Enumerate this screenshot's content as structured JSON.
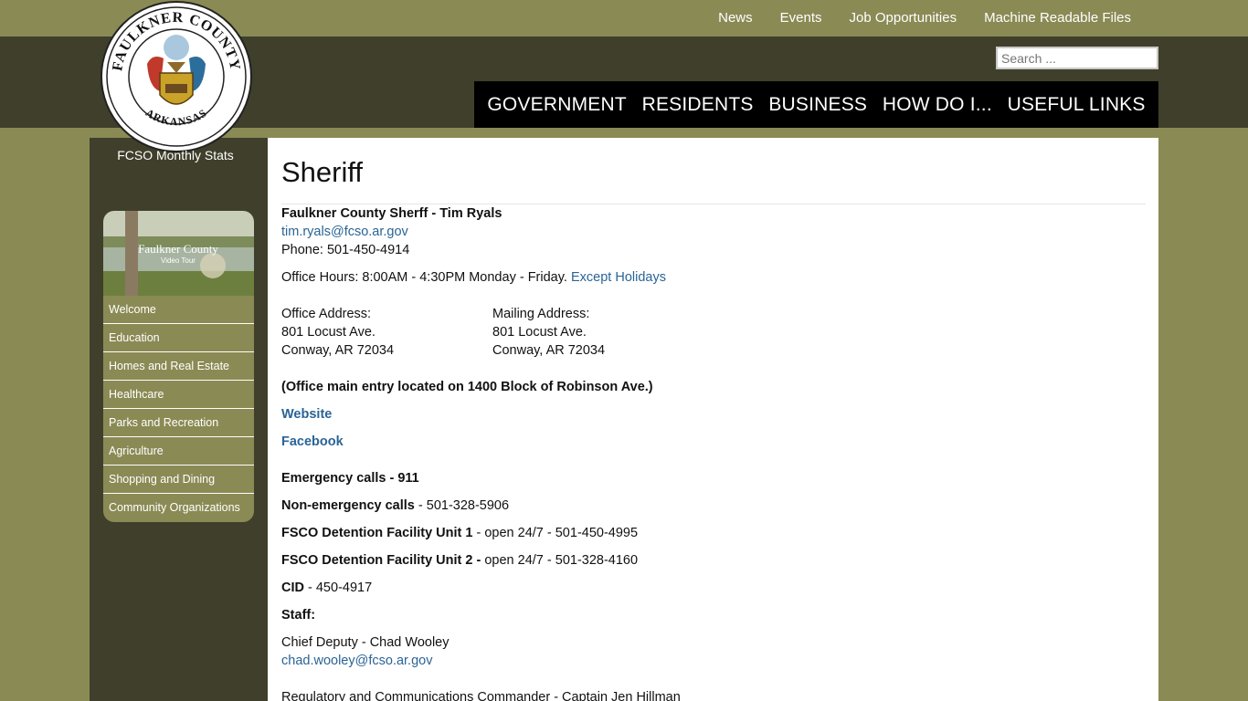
{
  "utility_nav": [
    "News",
    "Events",
    "Job Opportunities",
    "Machine Readable Files"
  ],
  "search": {
    "placeholder": "Search ..."
  },
  "main_nav": [
    "GOVERNMENT",
    "RESIDENTS",
    "BUSINESS",
    "HOW DO I...",
    "USEFUL LINKS"
  ],
  "seal": {
    "top_text": "FAULKNER COUNTY",
    "bottom_text": "ARKANSAS"
  },
  "sidebar": {
    "stats_label": "FCSO Monthly Stats",
    "video": {
      "title": "Faulkner County",
      "subtitle": "Video Tour"
    },
    "menu": [
      "Welcome",
      "Education",
      "Homes and Real Estate",
      "Healthcare",
      "Parks and Recreation",
      "Agriculture",
      "Shopping and Dining",
      "Community Organizations"
    ]
  },
  "page": {
    "title": "Sheriff",
    "sheriff_heading": "Faulkner County Sherff - Tim Ryals",
    "sheriff_email": "tim.ryals@fcso.ar.gov",
    "phone": "Phone: 501-450-4914",
    "hours_prefix": "Office Hours:  8:00AM - 4:30PM Monday - Friday.",
    "hours_link": "Except Holidays",
    "office_address": {
      "label": "Office Address:",
      "line1": "801 Locust Ave.",
      "line2": "Conway, AR 72034"
    },
    "mailing_address": {
      "label": "Mailing Address:",
      "line1": "801 Locust Ave.",
      "line2": "Conway, AR 72034"
    },
    "entry_note": "(Office main entry located on 1400 Block of Robinson Ave.)",
    "website_link": "Website",
    "facebook_link": "Facebook",
    "emergency": "Emergency calls - 911",
    "non_emergency": {
      "label": "Non-emergency calls",
      "value": " - 501-328-5906"
    },
    "unit1": {
      "label": "FSCO Detention Facility Unit 1",
      "value": " - open 24/7 - 501-450-4995"
    },
    "unit2": {
      "label": "FSCO Detention Facility Unit 2 -",
      "value": " open 24/7 - 501-328-4160"
    },
    "cid": {
      "label": "CID",
      "value": " - 450-4917"
    },
    "staff_heading": "Staff:",
    "chief_deputy": "Chief Deputy - Chad Wooley",
    "chief_deputy_email": "chad.wooley@fcso.ar.gov",
    "regulatory": "Regulatory and Communications Commander - Captain Jen Hillman"
  }
}
